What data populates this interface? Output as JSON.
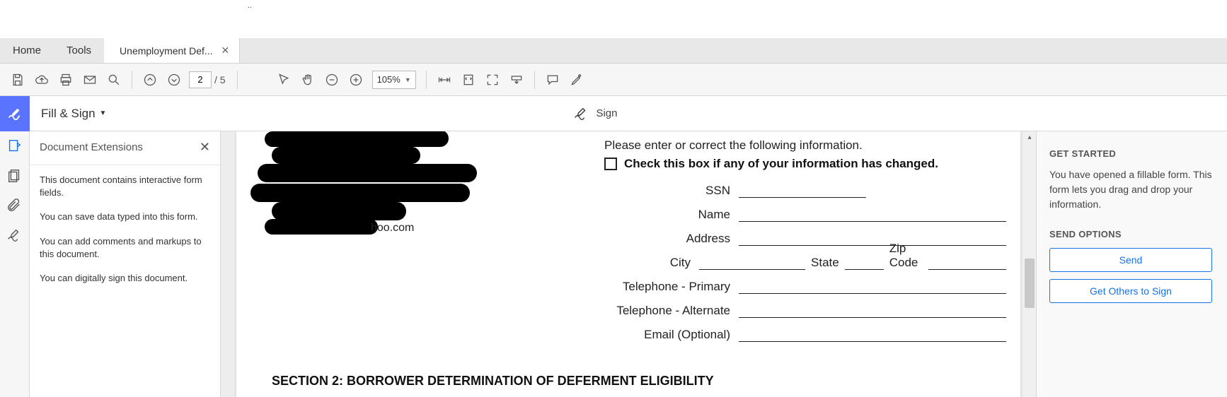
{
  "tabs": {
    "home": "Home",
    "tools": "Tools",
    "doc": "Unemployment Def..."
  },
  "toolbar": {
    "page_current": "2",
    "page_total": "/  5",
    "zoom": "105%"
  },
  "fillsign": {
    "title": "Fill & Sign",
    "sign": "Sign"
  },
  "ext": {
    "title": "Document Extensions",
    "p1": "This document contains interactive form fields.",
    "p2": "You can save data typed into this form.",
    "p3": "You can add comments and markups to this document.",
    "p4": "You can digitally sign this document."
  },
  "form": {
    "instruction": "Please enter or correct the following information.",
    "checkbox_label": "Check this box if any of your information has changed.",
    "ssn": "SSN",
    "name": "Name",
    "address": "Address",
    "city": "City",
    "state": "State",
    "zip": "Zip Code",
    "tel1": "Telephone - Primary",
    "tel2": "Telephone - Alternate",
    "email": "Email (Optional)",
    "left_email": "hoo.com",
    "section2": "SECTION 2: BORROWER DETERMINATION OF DEFERMENT ELIGIBILITY"
  },
  "right": {
    "hdr1": "GET STARTED",
    "txt1": "You have opened a fillable form. This form lets you drag and drop your information.",
    "hdr2": "SEND OPTIONS",
    "btn1": "Send",
    "btn2": "Get Others to Sign"
  }
}
